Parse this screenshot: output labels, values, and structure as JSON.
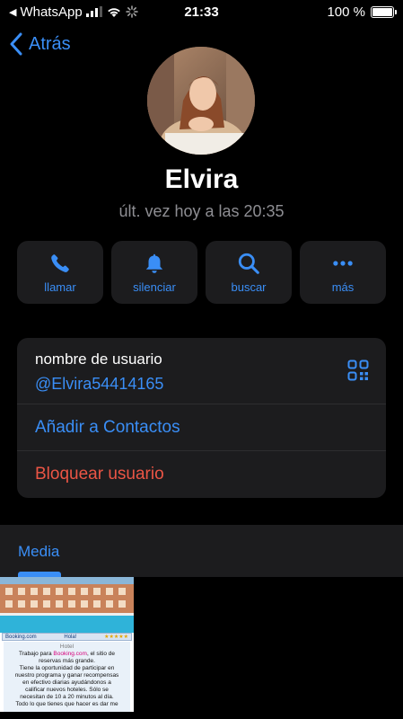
{
  "status_bar": {
    "back_app": "WhatsApp",
    "time": "21:33",
    "battery": "100 %",
    "battery_level": 1.0
  },
  "nav": {
    "back_label": "Atrás"
  },
  "profile": {
    "name": "Elvira",
    "last_seen": "últ. vez hoy a las 20:35"
  },
  "actions": [
    {
      "label": "llamar",
      "icon": "phone-icon"
    },
    {
      "label": "silenciar",
      "icon": "bell-icon"
    },
    {
      "label": "buscar",
      "icon": "search-icon"
    },
    {
      "label": "más",
      "icon": "more-icon"
    }
  ],
  "info": {
    "username_label": "nombre de usuario",
    "username": "@Elvira54414165",
    "add_contact": "Añadir a Contactos",
    "block_user": "Bloquear usuario"
  },
  "media": {
    "label": "Media",
    "thumb": {
      "site": "Booking.com",
      "hello": "Hola!",
      "hotel": "Hotel",
      "line1a": "Trabajo para ",
      "line1b": "Booking.com",
      "line1c": ", el sitio de",
      "line2": "reservas más grande.",
      "line3": "Tiene la oportunidad de participar en",
      "line4": "nuestro programa y ganar recompensas",
      "line5": "en efectivo diarias ayudándonos a",
      "line6": "calificar nuevos hoteles. Sólo se",
      "line7": "necesitan de 10 a 20 minutos al día.",
      "line8": "Todo lo que tienes que hacer es dar me"
    }
  },
  "colors": {
    "accent": "#3a8ef6",
    "danger": "#eb5545",
    "card": "#1c1c1e",
    "secondary_text": "#8e8e93"
  }
}
